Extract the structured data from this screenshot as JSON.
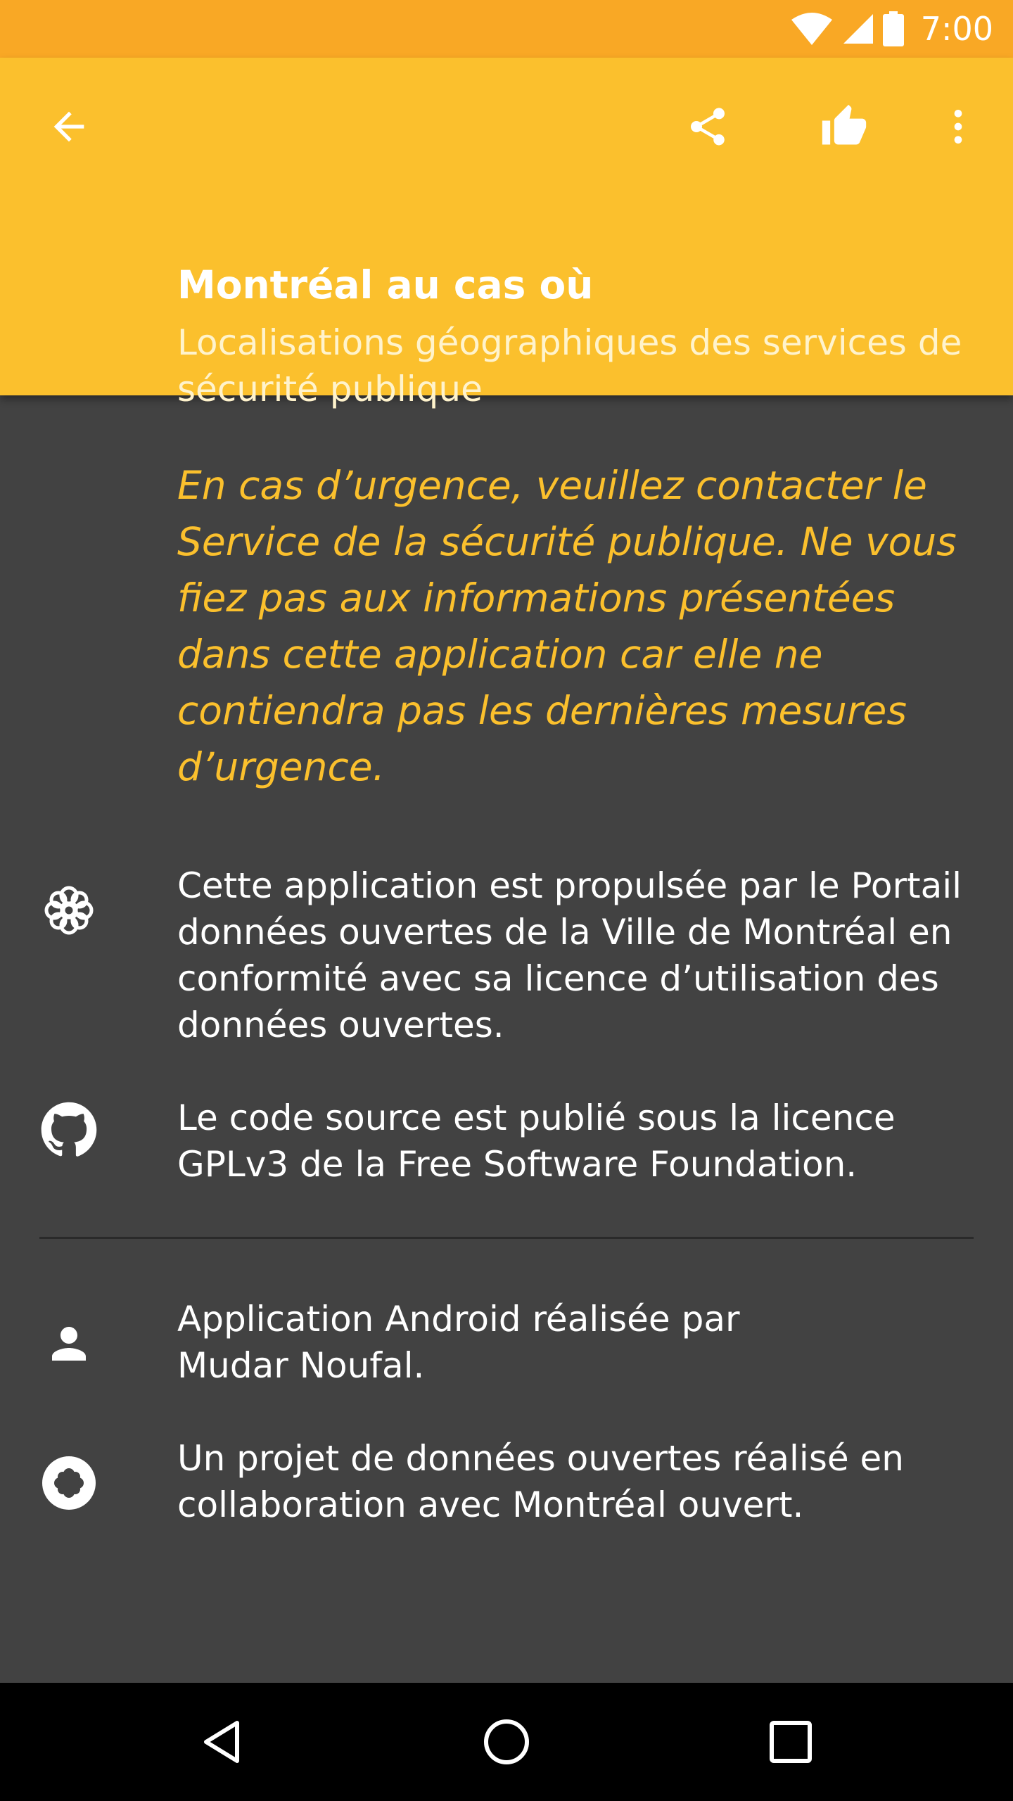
{
  "status_bar": {
    "time": "7:00",
    "icons": [
      "wifi-icon",
      "signal-icon",
      "battery-icon"
    ],
    "color": "#F9A825"
  },
  "app_bar": {
    "color": "#FBC02D",
    "title": "Montréal au cas où",
    "subtitle": "Localisations géographiques des services de sécurité publique",
    "actions": [
      "back-arrow-icon",
      "share-icon",
      "thumb-up-icon",
      "more-vert-icon"
    ]
  },
  "content": {
    "background": "#424242",
    "warning": "En cas d’urgence, veuillez contacter le Service de la sécurité publique. Ne vous fiez pas aux informations présentées dans cette application car elle ne contiendra pas les dernières mesures d’urgence.",
    "items": [
      {
        "icon": "montreal-logo-icon",
        "text": "Cette application est propulsée par le Portail données ouvertes de la Ville de Montréal en conformité avec sa licence d’utilisation des données ouvertes."
      },
      {
        "icon": "github-icon",
        "text": "Le code source est publié sous la licence GPLv3 de la Free Software Foundation."
      },
      {
        "icon": "person-icon",
        "text": "Application Android réalisée par Mudar Noufal."
      },
      {
        "icon": "montreal-ouvert-icon",
        "text": "Un projet de données ouvertes réalisé en collaboration avec Montréal ouvert."
      }
    ]
  },
  "nav_bar": {
    "buttons": [
      "back-triangle-icon",
      "home-circle-icon",
      "recents-square-icon"
    ]
  }
}
